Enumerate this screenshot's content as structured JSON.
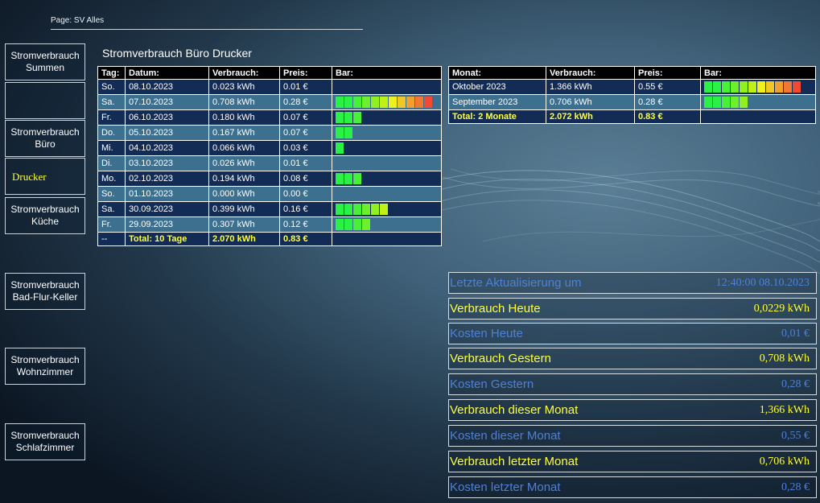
{
  "page_label": "Page: SV Alles",
  "title": "Stromverbrauch Büro Drucker",
  "nav": [
    {
      "label": "Stromverbrauch Summen"
    },
    {
      "label": ""
    },
    {
      "label": "Stromverbrauch Büro"
    },
    {
      "label": "Drucker"
    },
    {
      "label": "Stromverbrauch Küche"
    },
    {
      "label": "Stromverbrauch Bad-Flur-Keller"
    },
    {
      "label": "Stromverbrauch Wohnzimmer"
    },
    {
      "label": "Stromverbrauch Schlafzimmer"
    }
  ],
  "daily": {
    "headers": [
      "Tag:",
      "Datum:",
      "Verbrauch:",
      "Preis:",
      "Bar:"
    ],
    "rows": [
      {
        "tag": "So.",
        "datum": "08.10.2023",
        "verbrauch": "0.023 kWh",
        "preis": "0.01 €",
        "bar": 0
      },
      {
        "tag": "Sa.",
        "datum": "07.10.2023",
        "verbrauch": "0.708 kWh",
        "preis": "0.28 €",
        "bar": 11
      },
      {
        "tag": "Fr.",
        "datum": "06.10.2023",
        "verbrauch": "0.180 kWh",
        "preis": "0.07 €",
        "bar": 3
      },
      {
        "tag": "Do.",
        "datum": "05.10.2023",
        "verbrauch": "0.167 kWh",
        "preis": "0.07 €",
        "bar": 2
      },
      {
        "tag": "Mi.",
        "datum": "04.10.2023",
        "verbrauch": "0.066 kWh",
        "preis": "0.03 €",
        "bar": 1
      },
      {
        "tag": "Di.",
        "datum": "03.10.2023",
        "verbrauch": "0.026 kWh",
        "preis": "0.01 €",
        "bar": 0
      },
      {
        "tag": "Mo.",
        "datum": "02.10.2023",
        "verbrauch": "0.194 kWh",
        "preis": "0.08 €",
        "bar": 3
      },
      {
        "tag": "So.",
        "datum": "01.10.2023",
        "verbrauch": "0.000 kWh",
        "preis": "0.00 €",
        "bar": 0
      },
      {
        "tag": "Sa.",
        "datum": "30.09.2023",
        "verbrauch": "0.399 kWh",
        "preis": "0.16 €",
        "bar": 6
      },
      {
        "tag": "Fr.",
        "datum": "29.09.2023",
        "verbrauch": "0.307 kWh",
        "preis": "0.12 €",
        "bar": 4
      }
    ],
    "total": {
      "tag": "--",
      "datum": "Total: 10 Tage",
      "verbrauch": "2.070 kWh",
      "preis": "0.83 €"
    }
  },
  "monthly": {
    "headers": [
      "Monat:",
      "Verbrauch:",
      "Preis:",
      "Bar:"
    ],
    "rows": [
      {
        "monat": "Oktober 2023",
        "verbrauch": "1.366 kWh",
        "preis": "0.55 €",
        "bar": 11
      },
      {
        "monat": "September 2023",
        "verbrauch": "0.706 kWh",
        "preis": "0.28 €",
        "bar": 5
      }
    ],
    "total": {
      "monat": "Total: 2 Monate",
      "verbrauch": "2.072 kWh",
      "preis": "0.83 €"
    }
  },
  "bar_colors": [
    "#2bf045",
    "#2bf045",
    "#49f038",
    "#6cf02c",
    "#90f020",
    "#c0f018",
    "#f0f01e",
    "#f0c826",
    "#f0a02d",
    "#f07832",
    "#f04a35"
  ],
  "stats": [
    {
      "label": "Letzte Aktualisierung um",
      "value": "12:40:00 08.10.2023",
      "color": "blue"
    },
    {
      "label": "Verbrauch Heute",
      "value": "0,0229 kWh",
      "color": "yellow"
    },
    {
      "label": "Kosten Heute",
      "value": "0,01 €",
      "color": "blue"
    },
    {
      "label": "Verbrauch Gestern",
      "value": "0,708 kWh",
      "color": "yellow"
    },
    {
      "label": "Kosten Gestern",
      "value": "0,28 €",
      "color": "blue"
    },
    {
      "label": "Verbrauch dieser Monat",
      "value": "1,366 kWh",
      "color": "yellow"
    },
    {
      "label": "Kosten dieser Monat",
      "value": "0,55 €",
      "color": "blue"
    },
    {
      "label": "Verbrauch letzter Monat",
      "value": "0,706 kWh",
      "color": "yellow"
    },
    {
      "label": "Kosten letzter Monat",
      "value": "0,28 €",
      "color": "blue"
    }
  ]
}
